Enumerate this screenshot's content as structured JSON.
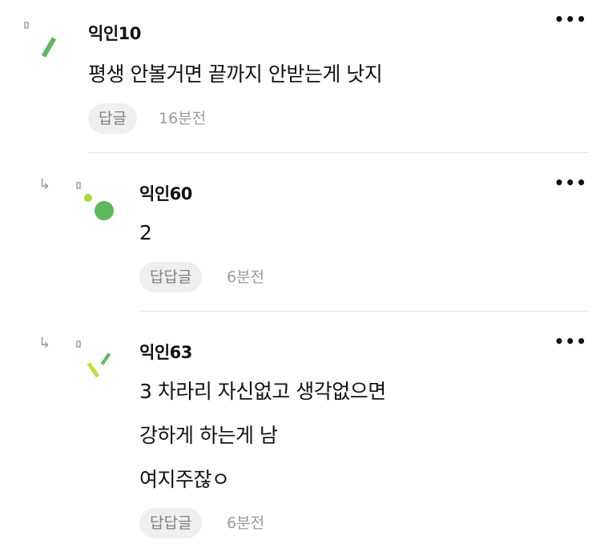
{
  "comments": [
    {
      "author": "익인10",
      "lines": [
        "평생 안볼거면 끝까지 안받는게 낫지"
      ],
      "reply_label": "답글",
      "time": "16분전",
      "more_label": "•••"
    },
    {
      "author": "익인60",
      "lines": [
        "2"
      ],
      "reply_label": "답답글",
      "time": "6분전",
      "more_label": "•••"
    },
    {
      "author": "익인63",
      "lines": [
        "3 차라리 자신없고 생각없으면",
        "강하게 하는게 남",
        "여지주잖ㅇ"
      ],
      "reply_label": "답답글",
      "time": "6분전",
      "more_label": "•••"
    }
  ],
  "reply_arrow_icon": "↳",
  "colors": {
    "avatar_green": "#5cb85c",
    "avatar_light_green": "#a8d83a",
    "avatar_yellow_green": "#c9dd3a",
    "divider": "#e6e6e6"
  }
}
